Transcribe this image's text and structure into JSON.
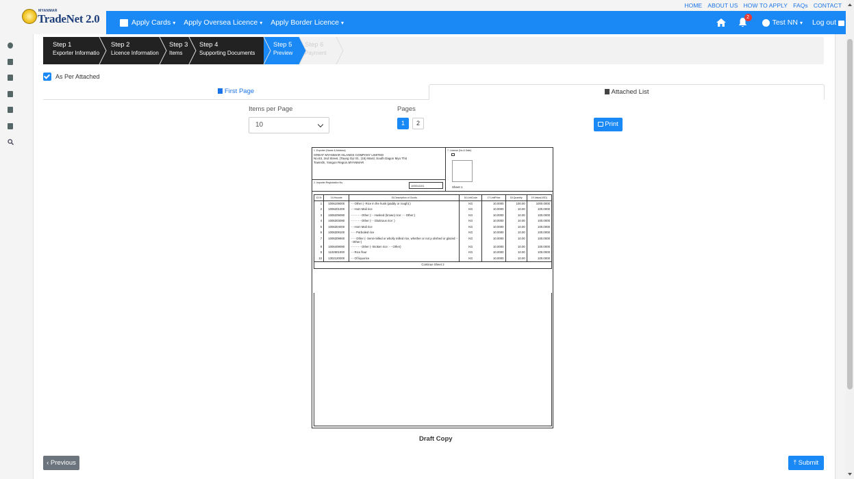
{
  "toplinks": [
    "HOME",
    "ABOUT US",
    "HOW TO APPLY",
    "FAQs",
    "CONTACT"
  ],
  "logo": {
    "small": "MYANMAR",
    "text": "TradeNet 2.0"
  },
  "menu": {
    "apply_cards": "Apply Cards",
    "apply_oversea": "Apply Oversea Licence",
    "apply_border": "Apply Border Licence"
  },
  "header": {
    "notification_count": "2",
    "user": "Test NN",
    "logout": "Log out"
  },
  "steps": [
    {
      "title": "Step 1",
      "sub": "Exporter Information",
      "state": "done"
    },
    {
      "title": "Step 2",
      "sub": "Licence Information",
      "state": "done"
    },
    {
      "title": "Step 3",
      "sub": "Items",
      "state": "done"
    },
    {
      "title": "Step 4",
      "sub": "Supporting Documents",
      "state": "done"
    },
    {
      "title": "Step 5",
      "sub": "Preview",
      "state": "active"
    },
    {
      "title": "Step 6",
      "sub": "Payment",
      "state": "future"
    }
  ],
  "as_per_attached": "As Per Attached",
  "tabs": {
    "first_page": "First Page",
    "attached_list": "Attached List"
  },
  "items_per_page": {
    "label": "Items per Page",
    "value": "10"
  },
  "pages": {
    "label": "Pages",
    "current": "1",
    "next": "2"
  },
  "print_label": "Print",
  "document": {
    "exporter_label": "1.  Exporter (Name & Address)",
    "exporter_name": "GREAT MYANMAR ISLANDS COMPANY LIMITED",
    "exporter_addr1": "No.63, 2nd Street, (Taung Gyi St., (15) Ward, South Dagon Myo Thit",
    "exporter_addr2": "Townshi, Yangon Region,MYANMAR",
    "licence_label": "7.  License (No & Date)",
    "importer_label": "2.  Importer Registration No.",
    "importer_no": "100011101",
    "sheet": "Sheet 1",
    "columns": [
      "13.Sr",
      "14.Hscode",
      "15.Description of Goods",
      "16.UnitCode",
      "17.UnitPrice",
      "18.Quantity",
      "19.Value(USD)"
    ],
    "rows": [
      [
        "1",
        "1006109000",
        "- - Other (- Rice in the husk (paddy or rough):)",
        "KG",
        "10.0000",
        "100.00",
        "1000.0000"
      ],
      [
        "2",
        "1006201000",
        "- - Hom Mali rice",
        "KG",
        "10.0000",
        "10.00",
        "100.0000"
      ],
      [
        "3",
        "1006209090",
        "- - - - - - Other (- - Husked (brown) rice: - - Other:)",
        "KG",
        "10.0000",
        "10.00",
        "100.0000"
      ],
      [
        "4",
        "1006303090",
        "- - - - - - Other (- - Glutinous rice: )",
        "KG",
        "10.0000",
        "10.00",
        "100.0000"
      ],
      [
        "5",
        "1006304000",
        "- - Hom Mali rice",
        "KG",
        "10.0000",
        "10.00",
        "100.0000"
      ],
      [
        "6",
        "1006309100",
        "- - - Parboiled rice",
        "KG",
        "10.0000",
        "10.00",
        "100.0000"
      ],
      [
        "7",
        "1006309900",
        "- - - Other (- Semi-milled or wholly milled rice, whether or not p olished or glazed: - - Other:)",
        "KG",
        "10.0000",
        "10.00",
        "100.0000"
      ],
      [
        "8",
        "1006409090",
        "- - - - - - Other (- Broken rice: - - Other)",
        "KG",
        "10.0000",
        "10.00",
        "100.0000"
      ],
      [
        "9",
        "1102901000",
        "- - Rice flour",
        "KG",
        "10.0000",
        "10.00",
        "100.0000"
      ],
      [
        "10",
        "1302120000",
        "- - Of liquorice",
        "KG",
        "10.0000",
        "10.00",
        "100.0000"
      ]
    ],
    "continue": "Continue Sheet 2"
  },
  "draft": "Draft Copy",
  "buttons": {
    "previous": "Previous",
    "submit": "Submit"
  }
}
